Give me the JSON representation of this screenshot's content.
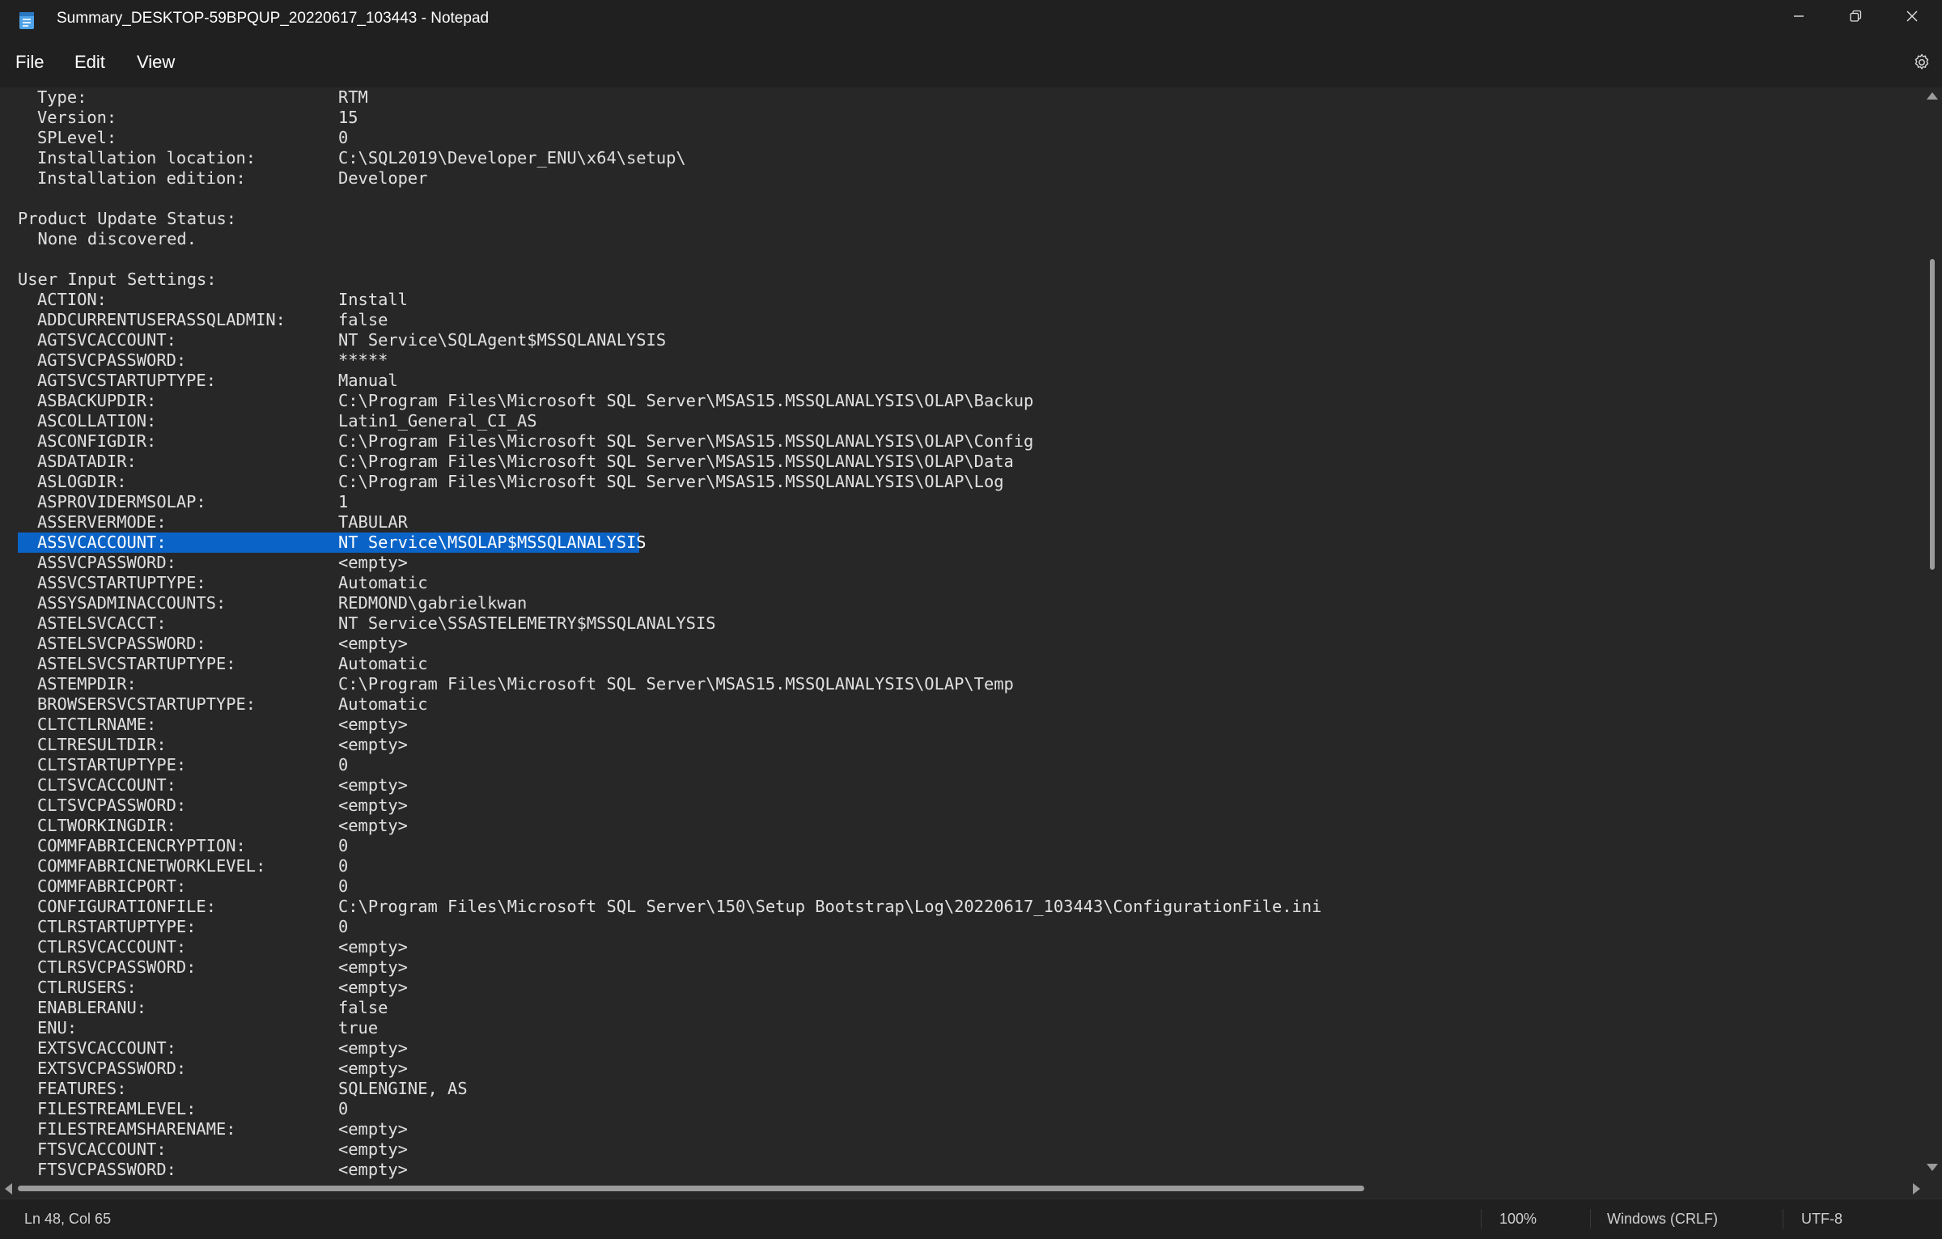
{
  "window": {
    "title": "Summary_DESKTOP-59BPQUP_20220617_103443 - Notepad",
    "icon": "notepad-icon",
    "controls": [
      "minimize-icon",
      "restore-icon",
      "close-icon"
    ]
  },
  "menu": {
    "file": "File",
    "edit": "Edit",
    "view": "View",
    "settings_icon": "gear-icon"
  },
  "colors": {
    "background": "#272727",
    "chrome": "#202020",
    "selection": "#0a64c8",
    "text": "#e0e0e0"
  },
  "editor": {
    "lines": [
      {
        "key": "Type:",
        "value": "RTM"
      },
      {
        "key": "Version:",
        "value": "15"
      },
      {
        "key": "SPLevel:",
        "value": "0"
      },
      {
        "key": "Installation location:",
        "value": "C:\\SQL2019\\Developer_ENU\\x64\\setup\\"
      },
      {
        "key": "Installation edition:",
        "value": "Developer"
      },
      {
        "text": ""
      },
      {
        "text": "Product Update Status:"
      },
      {
        "text": "  None discovered."
      },
      {
        "text": ""
      },
      {
        "text": "User Input Settings:"
      },
      {
        "key": "ACTION:",
        "value": "Install"
      },
      {
        "key": "ADDCURRENTUSERASSQLADMIN:",
        "value": "false"
      },
      {
        "key": "AGTSVCACCOUNT:",
        "value": "NT Service\\SQLAgent$MSSQLANALYSIS"
      },
      {
        "key": "AGTSVCPASSWORD:",
        "value": "*****"
      },
      {
        "key": "AGTSVCSTARTUPTYPE:",
        "value": "Manual"
      },
      {
        "key": "ASBACKUPDIR:",
        "value": "C:\\Program Files\\Microsoft SQL Server\\MSAS15.MSSQLANALYSIS\\OLAP\\Backup"
      },
      {
        "key": "ASCOLLATION:",
        "value": "Latin1_General_CI_AS"
      },
      {
        "key": "ASCONFIGDIR:",
        "value": "C:\\Program Files\\Microsoft SQL Server\\MSAS15.MSSQLANALYSIS\\OLAP\\Config"
      },
      {
        "key": "ASDATADIR:",
        "value": "C:\\Program Files\\Microsoft SQL Server\\MSAS15.MSSQLANALYSIS\\OLAP\\Data"
      },
      {
        "key": "ASLOGDIR:",
        "value": "C:\\Program Files\\Microsoft SQL Server\\MSAS15.MSSQLANALYSIS\\OLAP\\Log"
      },
      {
        "key": "ASPROVIDERMSOLAP:",
        "value": "1"
      },
      {
        "key": "ASSERVERMODE:",
        "value": "TABULAR"
      },
      {
        "key": "ASSVCACCOUNT:",
        "value": "NT Service\\MSOLAP$MSSQLANALYSIS",
        "selected": true
      },
      {
        "key": "ASSVCPASSWORD:",
        "value": "<empty>"
      },
      {
        "key": "ASSVCSTARTUPTYPE:",
        "value": "Automatic"
      },
      {
        "key": "ASSYSADMINACCOUNTS:",
        "value": "REDMOND\\gabrielkwan"
      },
      {
        "key": "ASTELSVCACCT:",
        "value": "NT Service\\SSASTELEMETRY$MSSQLANALYSIS"
      },
      {
        "key": "ASTELSVCPASSWORD:",
        "value": "<empty>"
      },
      {
        "key": "ASTELSVCSTARTUPTYPE:",
        "value": "Automatic"
      },
      {
        "key": "ASTEMPDIR:",
        "value": "C:\\Program Files\\Microsoft SQL Server\\MSAS15.MSSQLANALYSIS\\OLAP\\Temp"
      },
      {
        "key": "BROWSERSVCSTARTUPTYPE:",
        "value": "Automatic"
      },
      {
        "key": "CLTCTLRNAME:",
        "value": "<empty>"
      },
      {
        "key": "CLTRESULTDIR:",
        "value": "<empty>"
      },
      {
        "key": "CLTSTARTUPTYPE:",
        "value": "0"
      },
      {
        "key": "CLTSVCACCOUNT:",
        "value": "<empty>"
      },
      {
        "key": "CLTSVCPASSWORD:",
        "value": "<empty>"
      },
      {
        "key": "CLTWORKINGDIR:",
        "value": "<empty>"
      },
      {
        "key": "COMMFABRICENCRYPTION:",
        "value": "0"
      },
      {
        "key": "COMMFABRICNETWORKLEVEL:",
        "value": "0"
      },
      {
        "key": "COMMFABRICPORT:",
        "value": "0"
      },
      {
        "key": "CONFIGURATIONFILE:",
        "value": "C:\\Program Files\\Microsoft SQL Server\\150\\Setup Bootstrap\\Log\\20220617_103443\\ConfigurationFile.ini"
      },
      {
        "key": "CTLRSTARTUPTYPE:",
        "value": "0"
      },
      {
        "key": "CTLRSVCACCOUNT:",
        "value": "<empty>"
      },
      {
        "key": "CTLRSVCPASSWORD:",
        "value": "<empty>"
      },
      {
        "key": "CTLRUSERS:",
        "value": "<empty>"
      },
      {
        "key": "ENABLERANU:",
        "value": "false"
      },
      {
        "key": "ENU:",
        "value": "true"
      },
      {
        "key": "EXTSVCACCOUNT:",
        "value": "<empty>"
      },
      {
        "key": "EXTSVCPASSWORD:",
        "value": "<empty>"
      },
      {
        "key": "FEATURES:",
        "value": "SQLENGINE, AS"
      },
      {
        "key": "FILESTREAMLEVEL:",
        "value": "0"
      },
      {
        "key": "FILESTREAMSHARENAME:",
        "value": "<empty>"
      },
      {
        "key": "FTSVCACCOUNT:",
        "value": "<empty>"
      },
      {
        "key": "FTSVCPASSWORD:",
        "value": "<empty>"
      }
    ]
  },
  "scroll": {
    "vertical_position": 0.3,
    "horizontal_position": 0.0
  },
  "status": {
    "position": "Ln 48, Col 65",
    "zoom": "100%",
    "line_ending": "Windows (CRLF)",
    "encoding": "UTF-8"
  }
}
